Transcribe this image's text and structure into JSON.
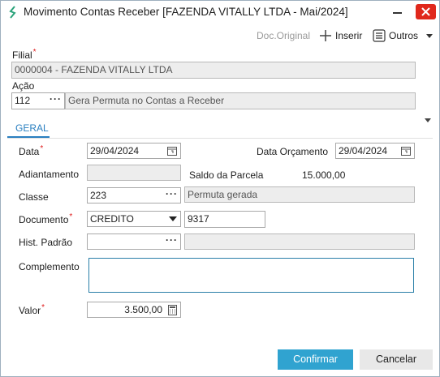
{
  "window": {
    "title": "Movimento Contas Receber [FAZENDA VITALLY LTDA - Mai/2024]"
  },
  "toolbar": {
    "doc_original": "Doc.Original",
    "inserir": "Inserir",
    "outros": "Outros"
  },
  "header": {
    "filial_label": "Filial",
    "filial_value": "0000004 - FAZENDA VITALLY LTDA",
    "acao_label": "Ação",
    "acao_code": "112",
    "acao_desc": "Gera Permuta no Contas a Receber"
  },
  "tabs": [
    {
      "label": "GERAL"
    }
  ],
  "form": {
    "data_label": "Data",
    "data_value": "29/04/2024",
    "data_orc_label": "Data Orçamento",
    "data_orc_value": "29/04/2024",
    "adiantamento_label": "Adiantamento",
    "adiantamento_value": "",
    "saldo_label": "Saldo da Parcela",
    "saldo_value": "15.000,00",
    "classe_label": "Classe",
    "classe_code": "223",
    "classe_desc": "Permuta gerada",
    "documento_label": "Documento",
    "documento_value": "CREDITO",
    "documento_num": "9317",
    "hist_label": "Hist. Padrão",
    "hist_code": "",
    "hist_desc": "",
    "complemento_label": "Complemento",
    "complemento_value": "",
    "valor_label": "Valor",
    "valor_value": "3.500,00"
  },
  "buttons": {
    "confirmar": "Confirmar",
    "cancelar": "Cancelar"
  },
  "colors": {
    "accent": "#30a3d0",
    "tab_accent": "#2a7fc0",
    "required": "#e02020",
    "close_button": "#e0281c"
  }
}
